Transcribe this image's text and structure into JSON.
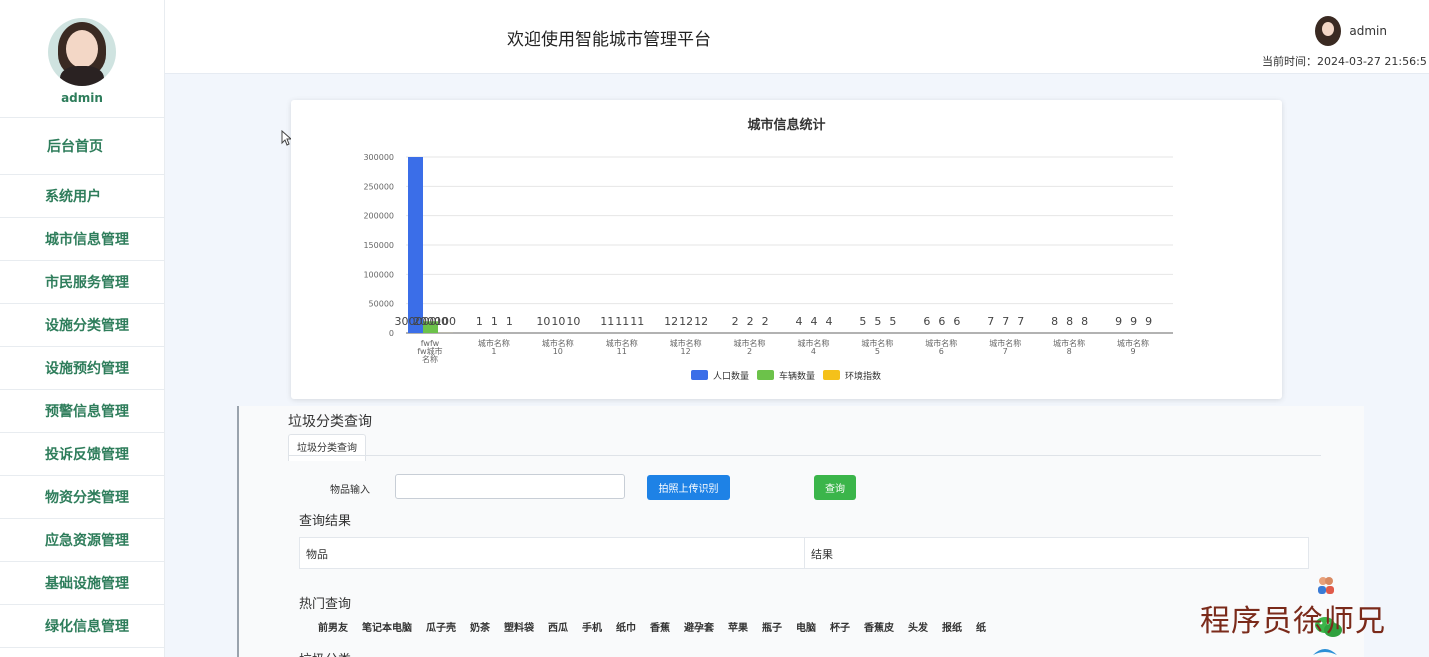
{
  "sidebar": {
    "username": "admin",
    "items": [
      {
        "label": "后台首页"
      },
      {
        "label": "系统用户"
      },
      {
        "label": "城市信息管理"
      },
      {
        "label": "市民服务管理"
      },
      {
        "label": "设施分类管理"
      },
      {
        "label": "设施预约管理"
      },
      {
        "label": "预警信息管理"
      },
      {
        "label": "投诉反馈管理"
      },
      {
        "label": "物资分类管理"
      },
      {
        "label": "应急资源管理"
      },
      {
        "label": "基础设施管理"
      },
      {
        "label": "绿化信息管理"
      }
    ]
  },
  "header": {
    "title": "欢迎使用智能城市管理平台",
    "username": "admin",
    "time": "当前时间：2024-03-27 21:56:5"
  },
  "chart_data": {
    "type": "bar",
    "title": "城市信息统计",
    "categories": [
      [
        "fwfw",
        "fw城市",
        "名称"
      ],
      [
        "城市名称",
        "1"
      ],
      [
        "城市名称",
        "10"
      ],
      [
        "城市名称",
        "11"
      ],
      [
        "城市名称",
        "12"
      ],
      [
        "城市名称",
        "2"
      ],
      [
        "城市名称",
        "4"
      ],
      [
        "城市名称",
        "5"
      ],
      [
        "城市名称",
        "6"
      ],
      [
        "城市名称",
        "7"
      ],
      [
        "城市名称",
        "8"
      ],
      [
        "城市名称",
        "9"
      ]
    ],
    "series": [
      {
        "name": "人口数量",
        "color": "#3b6ee8",
        "values": [
          300000,
          1,
          10,
          11,
          12,
          2,
          4,
          5,
          6,
          7,
          8,
          9
        ]
      },
      {
        "name": "车辆数量",
        "color": "#6cc24a",
        "values": [
          20000,
          1,
          10,
          11,
          12,
          2,
          4,
          5,
          6,
          7,
          8,
          9
        ]
      },
      {
        "name": "环境指数",
        "color": "#f5c11a",
        "values": [
          100,
          1,
          10,
          11,
          12,
          2,
          4,
          5,
          6,
          7,
          8,
          9
        ]
      }
    ],
    "data_labels": [
      "300000",
      "20000",
      "100"
    ],
    "yticks": [
      "0",
      "50000",
      "100000",
      "150000",
      "200000",
      "250000",
      "300000"
    ],
    "ylim": [
      0,
      300000
    ],
    "grid": true,
    "legend": "bottom"
  },
  "garbage": {
    "title": "垃圾分类查询",
    "tab": "垃圾分类查询",
    "input_label": "物品输入",
    "input_value": "",
    "upload_button": "拍照上传识别",
    "query_button": "查询",
    "result_title": "查询结果",
    "columns": [
      "物品",
      "结果"
    ],
    "hot_title": "热门查询",
    "hot_items": [
      "前男友",
      "笔记本电脑",
      "瓜子壳",
      "奶茶",
      "塑料袋",
      "西瓜",
      "手机",
      "纸巾",
      "香蕉",
      "避孕套",
      "苹果",
      "瓶子",
      "电脑",
      "杯子",
      "香蕉皮",
      "头发",
      "报纸",
      "纸"
    ],
    "next_title": "垃圾分类"
  },
  "watermark": {
    "text": "程序员徐师兄"
  }
}
